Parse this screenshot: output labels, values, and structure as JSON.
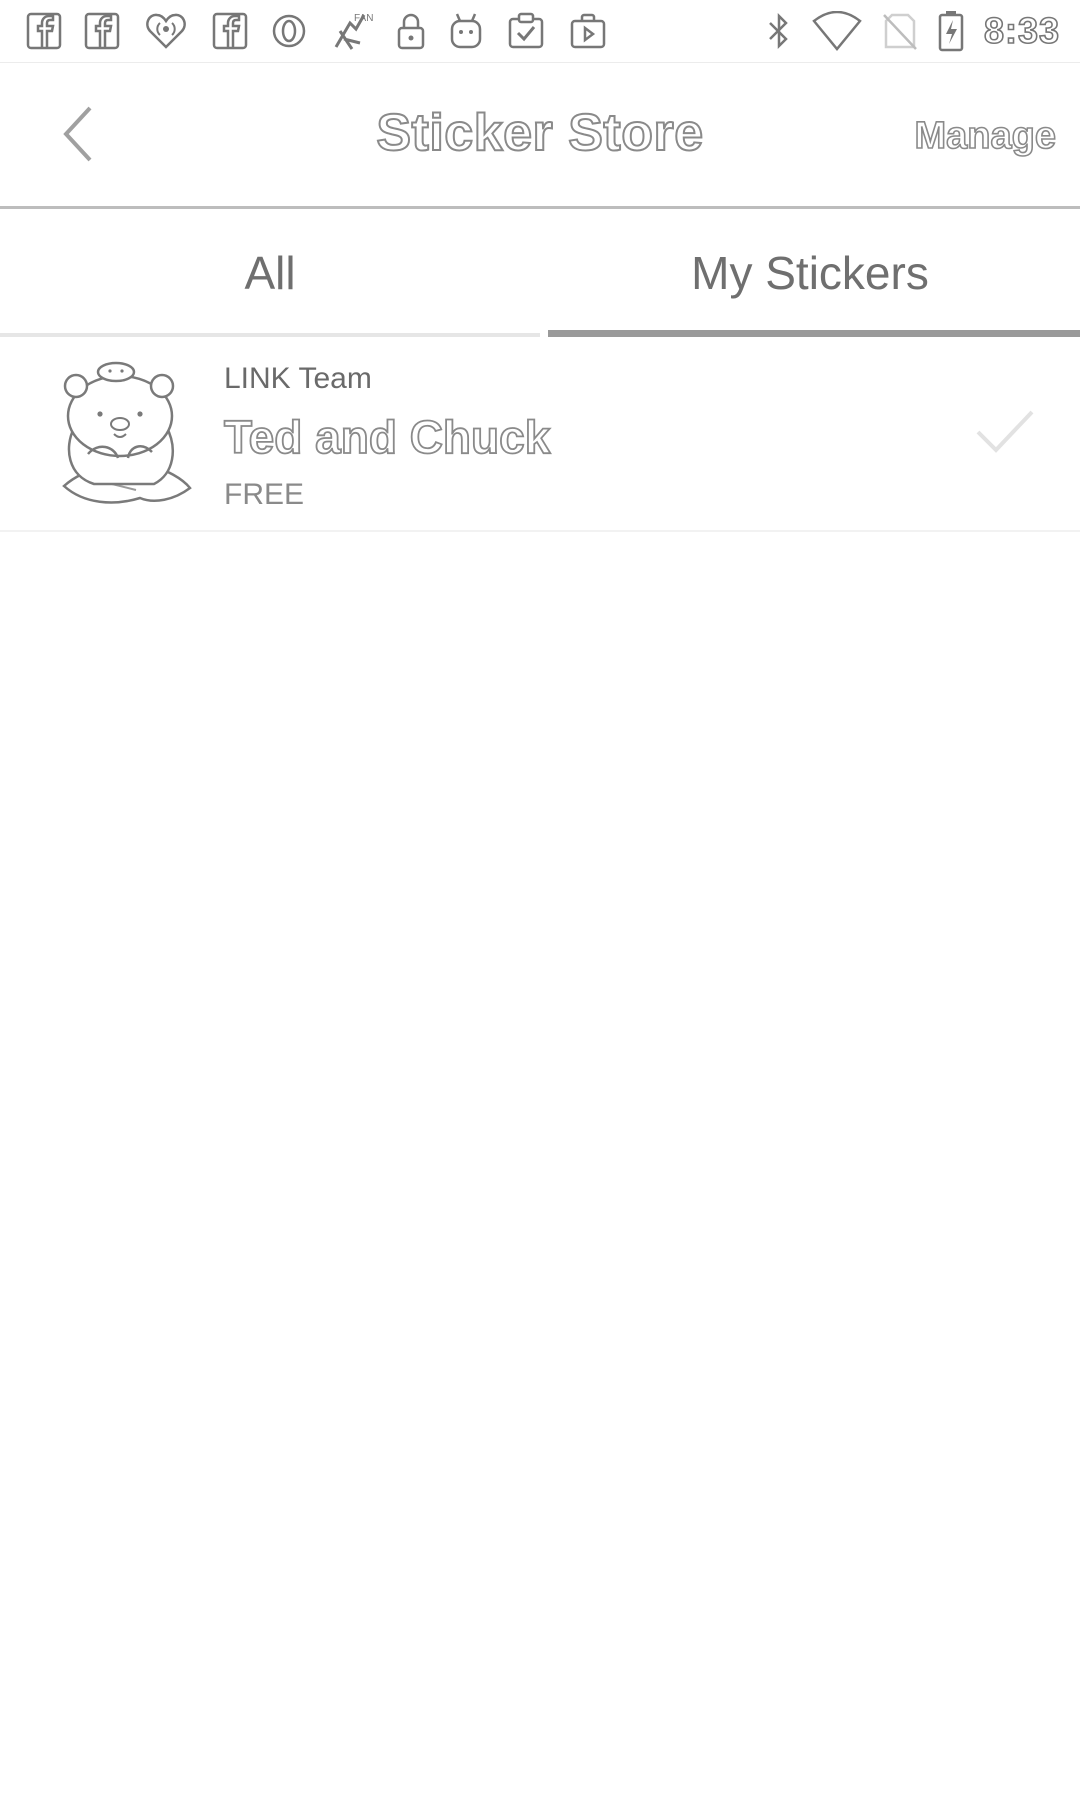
{
  "status_bar": {
    "time": "8:33",
    "left_icons": [
      "facebook-icon",
      "facebook-icon",
      "iheartradio-icon",
      "facebook-icon",
      "opera-icon",
      "fandango-icon",
      "lock-icon",
      "android-icon",
      "clipboard-check-icon",
      "play-store-icon"
    ],
    "right_icons": [
      "bluetooth-icon",
      "wifi-icon",
      "no-sim-icon",
      "battery-charging-icon"
    ]
  },
  "header": {
    "title": "Sticker Store",
    "manage_label": "Manage",
    "back_icon": "chevron-left-icon"
  },
  "tabs": [
    {
      "label": "All",
      "active": false
    },
    {
      "label": "My Stickers",
      "active": true
    }
  ],
  "stickers": [
    {
      "author": "LINK Team",
      "title": "Ted and Chuck",
      "price": "FREE",
      "downloaded": true,
      "thumbnail_icon": "bear-sticker-icon"
    }
  ]
}
